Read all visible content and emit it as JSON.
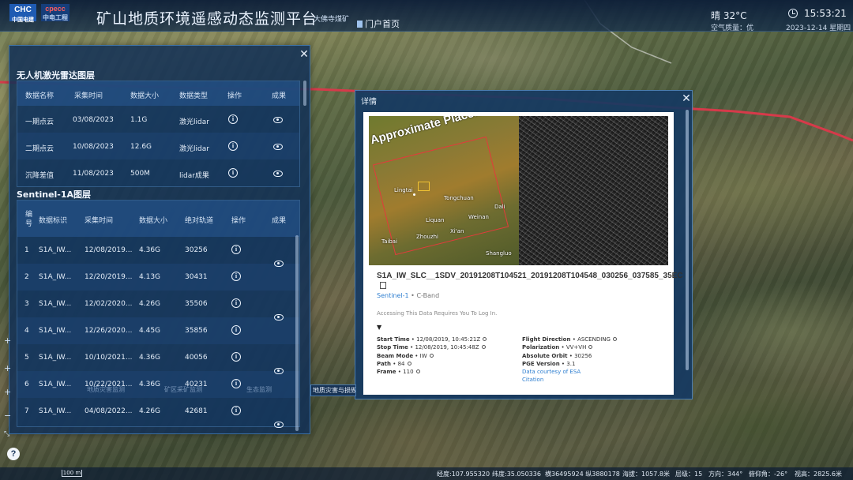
{
  "header": {
    "title": "矿山地质环境遥感动态监测平台",
    "subtitle": "大佛寺煤矿",
    "portal": "门户首页",
    "weather": "晴 32°C",
    "air_quality": "空气质量：优",
    "time": "15:53:21",
    "date": "2023-12-14 星期四",
    "logo1": "CHC 中国电建",
    "logo2": "cpecc 中电工程"
  },
  "uav": {
    "title": "无人机激光雷达图层",
    "columns": [
      "数据名称",
      "采集时间",
      "数据大小",
      "数据类型",
      "操作",
      "成果"
    ],
    "rows": [
      {
        "name": "一期点云",
        "date": "03/08/2023",
        "size": "1.1G",
        "type": "激光lidar"
      },
      {
        "name": "二期点云",
        "date": "10/08/2023",
        "size": "12.6G",
        "type": "激光lidar"
      },
      {
        "name": "沉降差值",
        "date": "11/08/2023",
        "size": "500M",
        "type": "lidar成果"
      }
    ]
  },
  "sentinel": {
    "title": "Sentinel-1A图层",
    "columns": [
      "编号",
      "数据标识",
      "采集时间",
      "数据大小",
      "绝对轨道",
      "操作",
      "成果"
    ],
    "rows": [
      {
        "no": "1",
        "id": "S1A_IW...",
        "date": "12/08/2019...",
        "size": "4.36G",
        "orbit": "30256"
      },
      {
        "no": "2",
        "id": "S1A_IW...",
        "date": "12/20/2019...",
        "size": "4.13G",
        "orbit": "30431"
      },
      {
        "no": "3",
        "id": "S1A_IW...",
        "date": "12/02/2020...",
        "size": "4.26G",
        "orbit": "35506"
      },
      {
        "no": "4",
        "id": "S1A_IW...",
        "date": "12/26/2020...",
        "size": "4.45G",
        "orbit": "35856"
      },
      {
        "no": "5",
        "id": "S1A_IW...",
        "date": "10/10/2021...",
        "size": "4.36G",
        "orbit": "40056"
      },
      {
        "no": "6",
        "id": "S1A_IW...",
        "date": "10/22/2021...",
        "size": "4.36G",
        "orbit": "40231"
      },
      {
        "no": "7",
        "id": "S1A_IW...",
        "date": "04/08/2022...",
        "size": "4.26G",
        "orbit": "42681"
      }
    ]
  },
  "detail": {
    "title": "详情",
    "placement": "Approximate Placement Only",
    "granule": "S1A_IW_SLC__1SDV_20191208T104521_20191208T104548_030256_037585_35EC",
    "platform": "Sentinel-1",
    "band": "C-Band",
    "login_note": "Accessing This Data Requires You To Log In.",
    "cities": [
      "Lingtai",
      "Tongchuan",
      "Liquan",
      "Weinan",
      "Xi'an",
      "Zhouzhi",
      "Taibai",
      "Shangluo",
      "Dali"
    ],
    "left_meta": [
      {
        "k": "Start Time",
        "v": "12/08/2019, 10:45:21Z"
      },
      {
        "k": "Stop Time",
        "v": "12/08/2019, 10:45:48Z"
      },
      {
        "k": "Beam Mode",
        "v": "IW"
      },
      {
        "k": "Path",
        "v": "84"
      },
      {
        "k": "Frame",
        "v": "110"
      }
    ],
    "right_meta": [
      {
        "k": "Flight Direction",
        "v": "ASCENDING"
      },
      {
        "k": "Polarization",
        "v": "VV+VH"
      },
      {
        "k": "Absolute Orbit",
        "v": "30256"
      },
      {
        "k": "PGE Version",
        "v": "3.1"
      }
    ],
    "data_courtesy": "Data courtesy of ESA",
    "citation": "Citation"
  },
  "tab_label": "地质灾害与损毁",
  "ghost_labels": [
    "地质灾害监测",
    "矿区采矿监测",
    "生态监测"
  ],
  "status": {
    "scale": "100 m",
    "lng": "经度:107.955320",
    "lat": "纬度:35.050336",
    "xy": "横36495924 纵3880178",
    "alt": "海拔：1057.8米",
    "level": "层级：15",
    "heading": "方向：344°",
    "pitch": "俯仰角：-26°",
    "height": "视高：2825.6米"
  }
}
